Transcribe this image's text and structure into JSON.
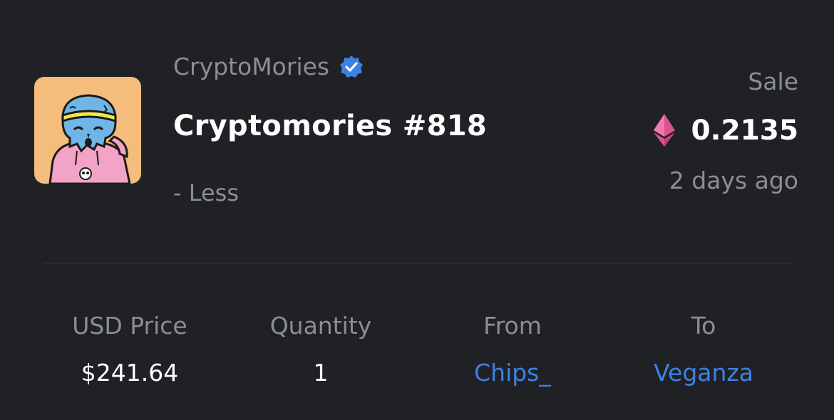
{
  "collection": {
    "name": "CryptoMories",
    "verified": true
  },
  "item": {
    "name": "Cryptomories #818",
    "toggle_label": "- Less"
  },
  "event": {
    "type": "Sale",
    "price": "0.2135",
    "currency_icon": "ethereum-icon",
    "time_ago": "2 days ago"
  },
  "stats": {
    "usd_price": {
      "label": "USD Price",
      "value": "$241.64"
    },
    "quantity": {
      "label": "Quantity",
      "value": "1"
    },
    "from": {
      "label": "From",
      "value": "Chips_"
    },
    "to": {
      "label": "To",
      "value": "Veganza"
    }
  },
  "colors": {
    "background": "#202125",
    "muted_text": "#8b8e94",
    "link": "#3b82e6",
    "verified_badge": "#3b82e6",
    "eth_pink": "#e0528f",
    "thumbnail_bg": "#f4bd7c"
  }
}
